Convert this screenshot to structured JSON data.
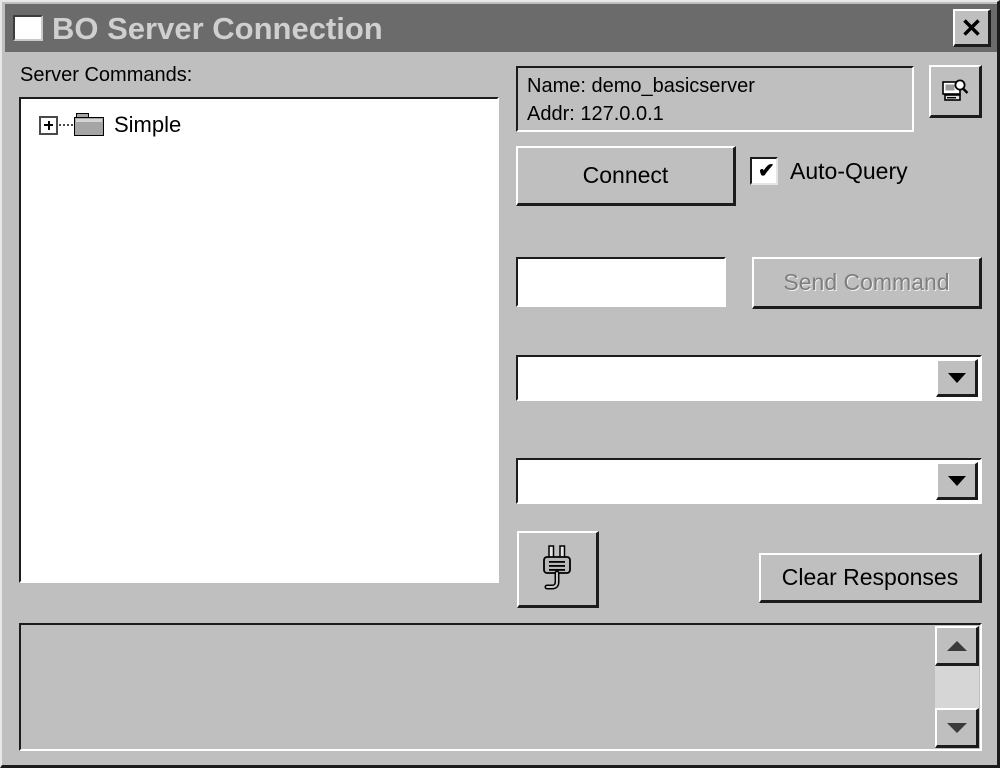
{
  "window": {
    "title": "BO Server Connection",
    "icon": "window-square-icon",
    "close_label": "✕",
    "background_color": "#bfbfbf",
    "titlebar_color": "#6b6b6b",
    "titlebar_text_color": "#cfcfcf"
  },
  "left_panel": {
    "label": "Server Commands:",
    "tree": {
      "nodes": [
        {
          "label": "Simple",
          "expander": "+",
          "expanded": false,
          "icon": "folder-icon"
        }
      ]
    }
  },
  "right_panel": {
    "server_info": {
      "name_line": "Name: demo_basicserver",
      "addr_line": "Addr: 127.0.0.1"
    },
    "browse_button": {
      "icon": "server-browse-icon",
      "tooltip": ""
    },
    "connect_button": {
      "label": "Connect",
      "enabled": true
    },
    "auto_query": {
      "label": "Auto-Query",
      "checked": true,
      "tick": "✔"
    },
    "command_input": {
      "value": "",
      "placeholder": ""
    },
    "send_command_button": {
      "label": "Send Command",
      "enabled": false,
      "disabled_text_color": "#7e7e7e"
    },
    "combo_one": {
      "value": "",
      "options": []
    },
    "combo_two": {
      "value": "",
      "options": []
    },
    "disconnect_button": {
      "icon": "power-plug-icon"
    },
    "clear_responses_button": {
      "label": "Clear Responses",
      "enabled": true
    }
  },
  "response_area": {
    "text": "",
    "scrollbar": {
      "up_arrow": "▲",
      "down_arrow": "▼"
    }
  }
}
